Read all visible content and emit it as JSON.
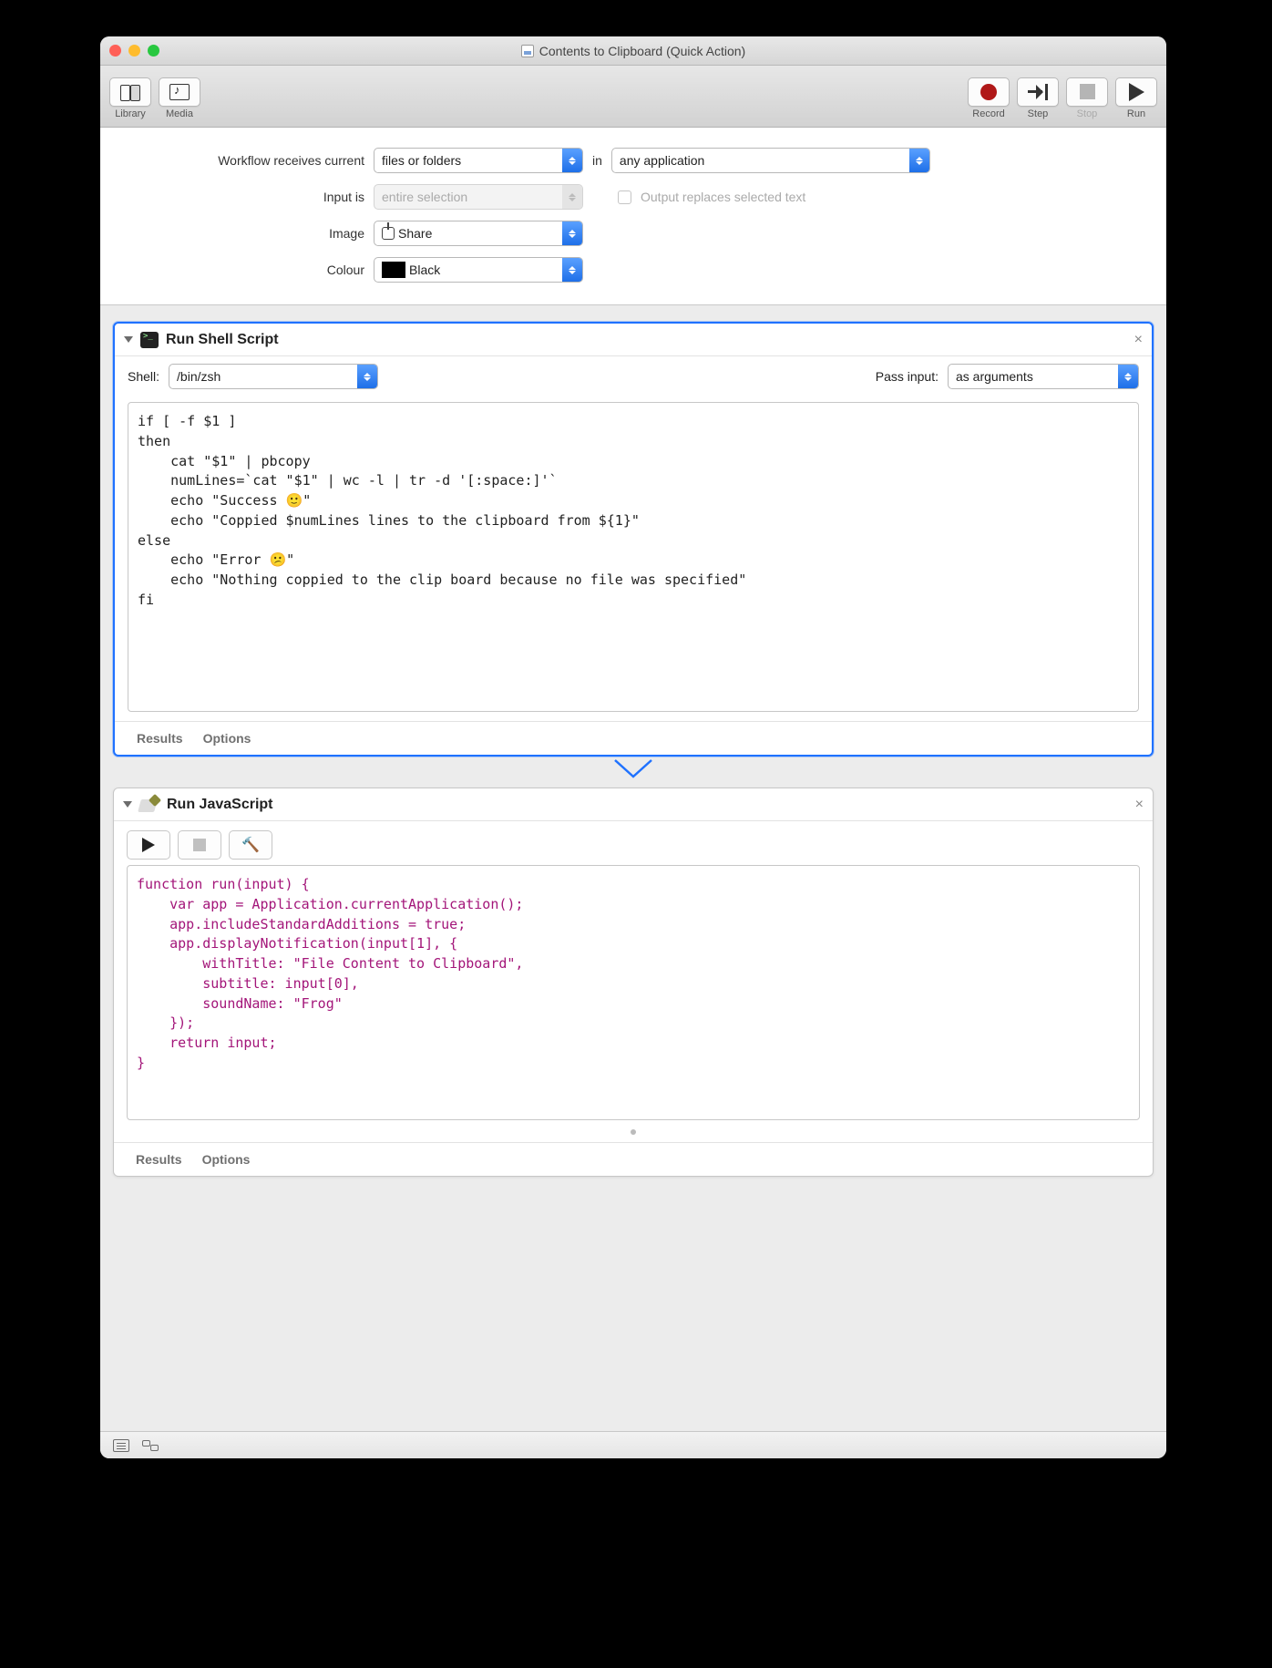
{
  "window": {
    "title": "Contents to Clipboard (Quick Action)"
  },
  "toolbar": {
    "library": "Library",
    "media": "Media",
    "record": "Record",
    "step": "Step",
    "stop": "Stop",
    "run": "Run"
  },
  "config": {
    "receives_label": "Workflow receives current",
    "receives_value": "files or folders",
    "in_word": "in",
    "app_value": "any application",
    "input_label": "Input is",
    "input_value": "entire selection",
    "replace_label": "Output replaces selected text",
    "image_label": "Image",
    "image_value": "Share",
    "colour_label": "Colour",
    "colour_value": "Black"
  },
  "action_shell": {
    "title": "Run Shell Script",
    "shell_label": "Shell:",
    "shell_value": "/bin/zsh",
    "passinput_label": "Pass input:",
    "passinput_value": "as arguments",
    "code": "if [ -f $1 ]\nthen\n    cat \"$1\" | pbcopy\n    numLines=`cat \"$1\" | wc -l | tr -d '[:space:]'`\n    echo \"Success 🙂\"\n    echo \"Coppied $numLines lines to the clipboard from ${1}\"\nelse\n    echo \"Error 😕\"\n    echo \"Nothing coppied to the clip board because no file was specified\"\nfi",
    "results": "Results",
    "options": "Options"
  },
  "action_js": {
    "title": "Run JavaScript",
    "code": "function run(input) {\n    var app = Application.currentApplication();\n    app.includeStandardAdditions = true;\n    app.displayNotification(input[1], {\n        withTitle: \"File Content to Clipboard\",\n        subtitle: input[0],\n        soundName: \"Frog\"\n    });\n    return input;\n}",
    "results": "Results",
    "options": "Options"
  }
}
